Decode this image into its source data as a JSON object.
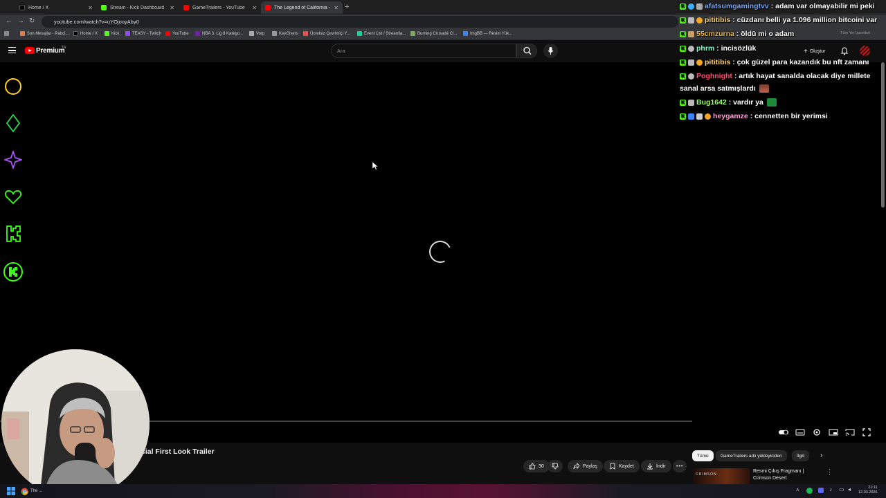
{
  "browser": {
    "tabs": [
      {
        "title": "Home / X",
        "color": "#000000"
      },
      {
        "title": "Stream - Kick Dashboard",
        "color": "#53fc18"
      },
      {
        "title": "GameTrailers - YouTube",
        "color": "#ff0000"
      },
      {
        "title": "The Legend of California - Offi...",
        "color": "#ff0000"
      }
    ],
    "url": "youtube.com/watch?v=uYOjouyAby0",
    "bookmarks": [
      "Son Mesajlar - Pabci...",
      "Home / X",
      "Kick",
      "TEASY - Twitch",
      "YouTube",
      "NBA 3. Lig 8 Katego...",
      "Vorp",
      "KeyGivers",
      "Ücretsiz Çevrimiçi Y...",
      "Event List / Streamla...",
      "Burning Crusade Cl...",
      "ImgBB — Resim Yük..."
    ],
    "bookmarks_right": "Tüm Yer İşaretleri"
  },
  "youtube": {
    "brand": "Premium",
    "region": "TR",
    "search_placeholder": "Ara",
    "create_label": "Oluştur",
    "video_title_partial": "cial First Look Trailer",
    "like_count": "30",
    "share_label": "Paylaş",
    "save_label": "Kaydet",
    "download_label": "İndir",
    "chips": [
      "Tümü",
      "GameTrailers adlı yükleyiciden",
      "İlgili"
    ],
    "related_title": "Resmi Çıkış Fragmanı | Crimson Desert",
    "related_thumb_text": "CRIMSON"
  },
  "chat": [
    {
      "user": "afatsumgamingtvv",
      "text": ": adam var olmayabilir mi peki",
      "color": "#6fa8ff"
    },
    {
      "user": "pititibis",
      "text": ": cüzdanı belli ya 1.096 million bitcoini var",
      "color": "#ffd36b"
    },
    {
      "user": "55cmzurna",
      "text": ": öldü mi o adam",
      "color": "#f0b83a"
    },
    {
      "user": "phrm",
      "text": ": incisözlük",
      "color": "#7fffd4"
    },
    {
      "user": "pititibis",
      "text": ": çok güzel para kazandık bu nft zamanı",
      "color": "#ffd36b"
    },
    {
      "user": "Poghnight",
      "text": ": artık hayat sanalda olacak diye millete",
      "text2": "sanal arsa satmışlardı",
      "color": "#ff4d6d"
    },
    {
      "user": "Bug1642",
      "text": ": vardır ya",
      "color": "#9dff6b"
    },
    {
      "user": "heygamze",
      "text": ": cennetten bir yerimsi",
      "color": "#ff9ed8"
    }
  ],
  "taskbar": {
    "chrome_label": "The ...",
    "time": "21:11",
    "date": "12.03.2026"
  }
}
